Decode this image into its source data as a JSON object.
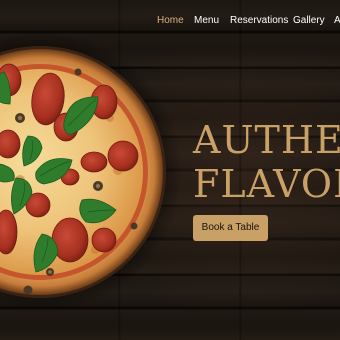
{
  "nav": {
    "items": [
      {
        "label": "Home",
        "active": true
      },
      {
        "label": "Menu",
        "active": false
      },
      {
        "label": "Reservations",
        "active": false
      },
      {
        "label": "Gallery",
        "active": false
      },
      {
        "label": "A",
        "active": false
      }
    ]
  },
  "hero": {
    "headline_line1": "AUTHEN",
    "headline_line2": "FLAVOR",
    "cta_label": "Book a Table",
    "image_icon": "pizza-image"
  },
  "colors": {
    "accent": "#c9a066",
    "nav_text": "#ffffff",
    "nav_active": "#d9b27c",
    "background": "#1a1510"
  }
}
